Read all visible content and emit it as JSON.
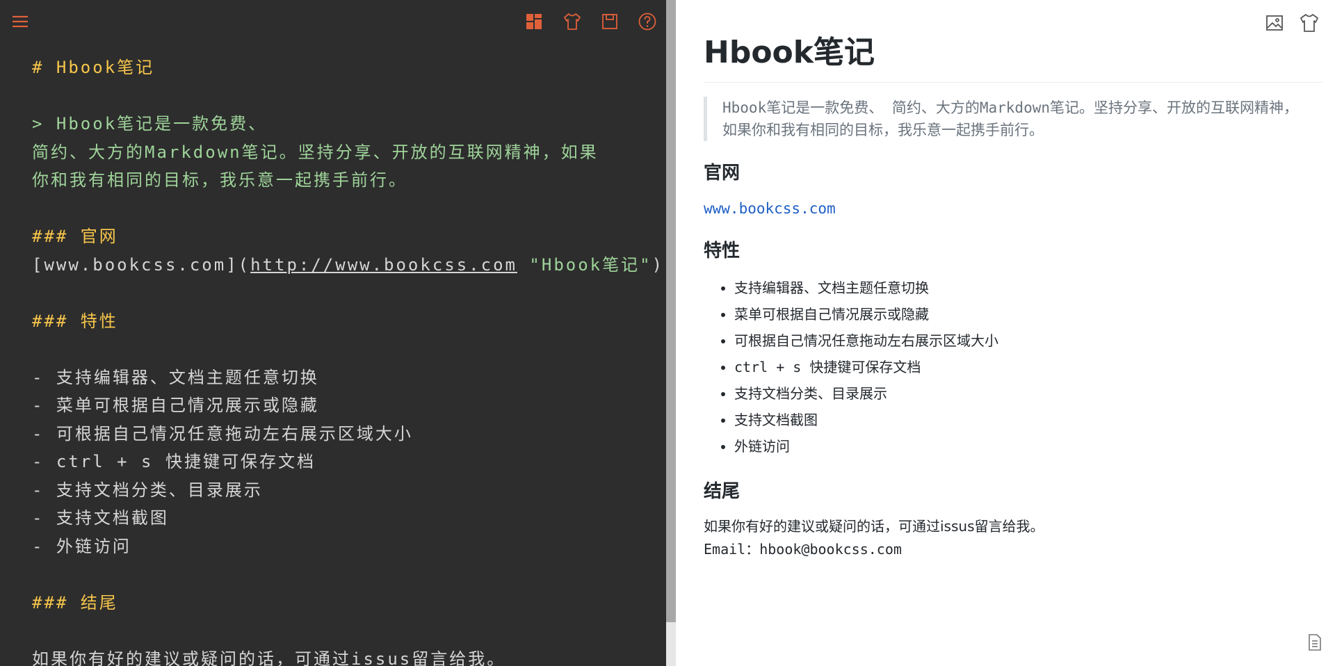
{
  "colors": {
    "editor_bg": "#2d2d2d",
    "toolbar_icon": "#e0603a",
    "heading": "#f7c64b",
    "quote": "#9fd49a",
    "editor_text": "#d6d6d6",
    "preview_link": "#1f5fc4",
    "divider": "#a8a8a8"
  },
  "toolbar": {
    "icons": [
      "menu-icon",
      "layout-icon",
      "theme-shirt-icon",
      "save-icon",
      "help-icon"
    ]
  },
  "editor": {
    "lines": {
      "l1": "# Hbook笔记",
      "l3": "> Hbook笔记是一款免费、",
      "l4": "简约、大方的Markdown笔记。坚持分享、开放的互联网精神，如果",
      "l5": "你和我有相同的目标，我乐意一起携手前行。",
      "l7": "### 官网",
      "l8_link_text": "[www.bookcss.com](",
      "l8_url": "http://www.bookcss.com",
      "l8_title": " \"Hbook笔记\"",
      "l8_close": ")",
      "l10": "### 特性",
      "l12": "- 支持编辑器、文档主题任意切换",
      "l13": "- 菜单可根据自己情况展示或隐藏",
      "l14": "- 可根据自己情况任意拖动左右展示区域大小",
      "l15": "- ctrl + s 快捷键可保存文档",
      "l16": "- 支持文档分类、目录展示",
      "l17": "- 支持文档截图",
      "l18": "- 外链访问",
      "l20": "### 结尾",
      "l22": "如果你有好的建议或疑问的话，可通过issus留言给我。"
    }
  },
  "preview": {
    "icons": [
      "image-icon",
      "theme-shirt-icon",
      "document-icon"
    ],
    "title": "Hbook笔记",
    "quote": "Hbook笔记是一款免费、 简约、大方的Markdown笔记。坚持分享、开放的互联网精神，如果你和我有相同的目标，我乐意一起携手前行。",
    "section_site": "官网",
    "site_link": "www.bookcss.com",
    "section_features": "特性",
    "features": [
      "支持编辑器、文档主题任意切换",
      "菜单可根据自己情况展示或隐藏",
      "可根据自己情况任意拖动左右展示区域大小",
      "ctrl + s 快捷键可保存文档",
      "支持文档分类、目录展示",
      "支持文档截图",
      "外链访问"
    ],
    "section_end": "结尾",
    "end_text": "如果你有好的建议或疑问的话，可通过issus留言给我。",
    "email_label": "Email：",
    "email": "hbook@bookcss.com"
  }
}
